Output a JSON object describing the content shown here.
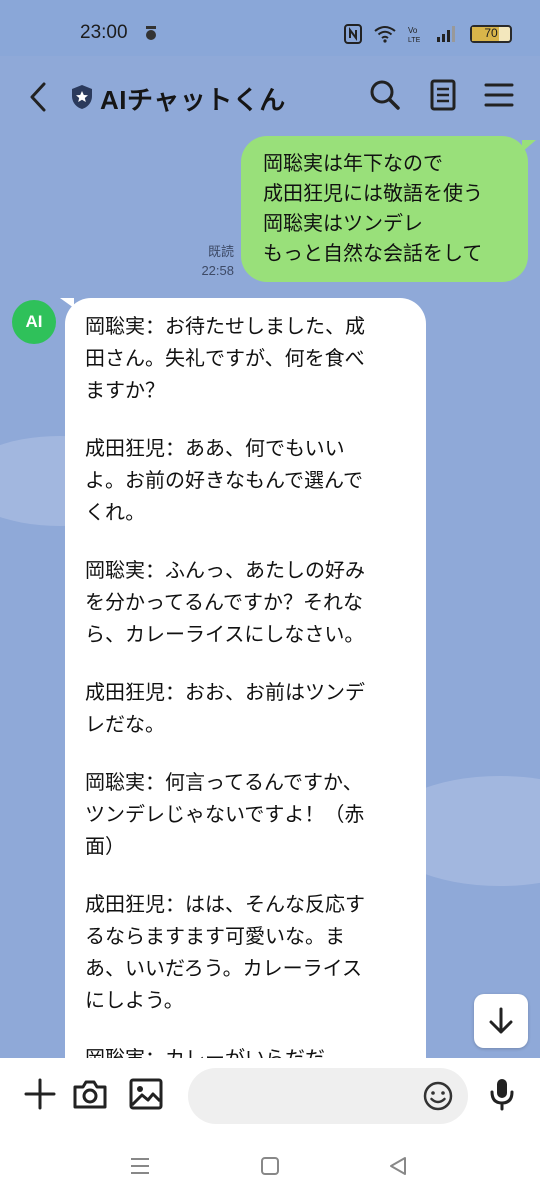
{
  "status_bar": {
    "time": "23:00",
    "battery_level": 70,
    "battery_text": "70",
    "app_icon": "notification-app-icon"
  },
  "header": {
    "title": "AIチャットくん",
    "icons": [
      "back-icon",
      "shield-star-icon",
      "search-icon",
      "notes-icon",
      "menu-icon"
    ]
  },
  "chat": {
    "sent_message": {
      "lines": [
        "岡聡実は年下なので",
        "成田狂児には敬語を使う",
        "岡聡実はツンデレ",
        "もっと自然な会話をして"
      ],
      "read_label": "既読",
      "time": "22:58"
    },
    "bot": {
      "avatar_text": "AI"
    },
    "received_message": {
      "paragraphs": [
        [
          "岡聡実：お待たせしました、成",
          "田さん。失礼ですが、何を食べ",
          "ますか？"
        ],
        [
          "成田狂児：ああ、何でもいい",
          "よ。お前の好きなもんで選んで",
          "くれ。"
        ],
        [
          "岡聡実：ふんっ、あたしの好み",
          "を分かってるんですか？それな",
          "ら、カレーライスにしなさい。"
        ],
        [
          "成田狂児：おお、お前はツンデ",
          "レだな。"
        ],
        [
          "岡聡実：何言ってるんですか、",
          "ツンデレじゃないですよ！（赤",
          "面）"
        ],
        [
          "成田狂児：はは、そんな反応す",
          "るならますます可愛いな。ま",
          "あ、いいだろう。カレーライス",
          "にしよう。"
        ]
      ],
      "partial_line": "岡聡実：カレーがいらだだ…"
    }
  },
  "input_bar": {
    "icons": [
      "plus-icon",
      "camera-icon",
      "image-icon",
      "emoji-icon",
      "microphone-icon"
    ],
    "placeholder": ""
  },
  "colors": {
    "chat_background": "#8fa9d8",
    "sent_bubble": "#99e07a",
    "received_bubble": "#ffffff",
    "ai_avatar": "#2fc15a"
  }
}
